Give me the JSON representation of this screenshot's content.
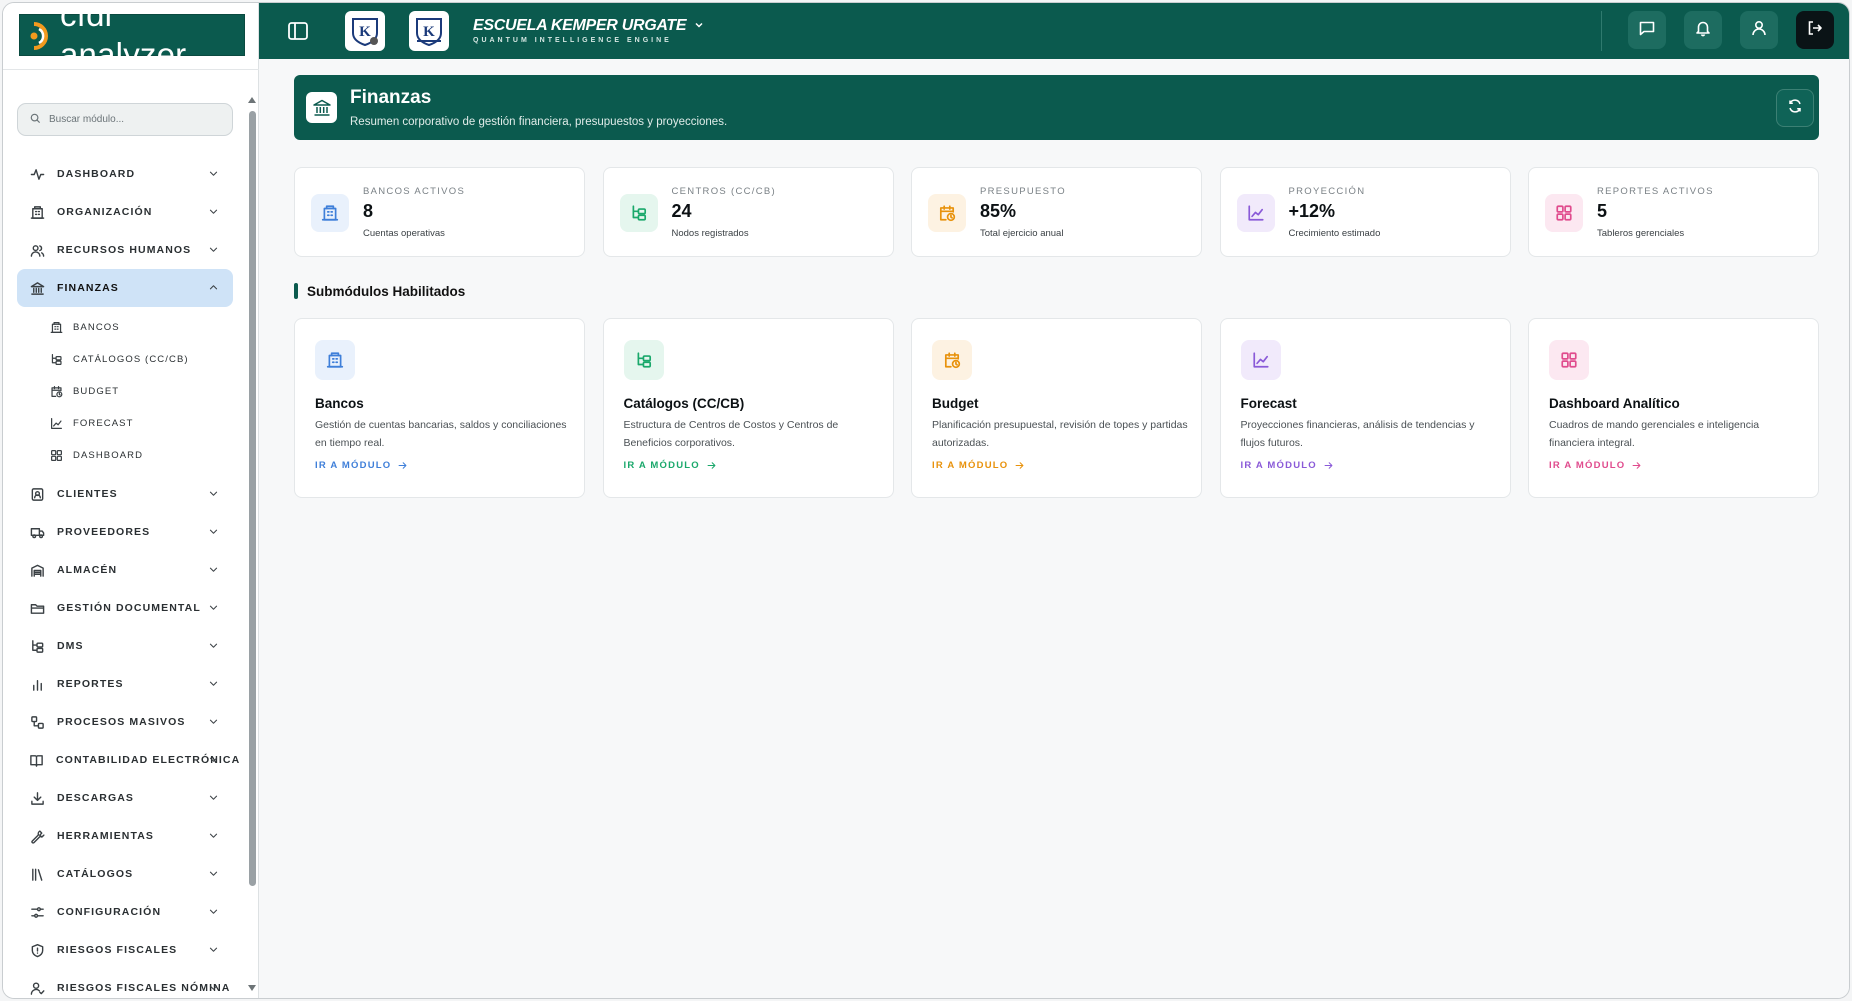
{
  "app": {
    "logo_text": "cfdi analyzer",
    "school_name": "ESCUELA KEMPER URGATE",
    "school_tagline": "QUANTUM INTELLIGENCE ENGINE",
    "badge_letter": "K"
  },
  "colors": {
    "brand": "#0b5a4e",
    "active_nav": "#cfe3f7",
    "blue": "#3f7fd9",
    "green": "#1aa86b",
    "orange": "#e8920c",
    "purple": "#8a5ad8",
    "pink": "#e04b8d"
  },
  "search": {
    "placeholder": "Buscar módulo..."
  },
  "sidebar": {
    "items": [
      {
        "label": "Dashboard",
        "icon": "activity-icon"
      },
      {
        "label": "Organización",
        "icon": "building-icon"
      },
      {
        "label": "Recursos Humanos",
        "icon": "users-icon"
      },
      {
        "label": "Finanzas",
        "icon": "landmark-icon",
        "active": true
      },
      {
        "label": "Clientes",
        "icon": "contact-icon"
      },
      {
        "label": "Proveedores",
        "icon": "truck-icon"
      },
      {
        "label": "Almacén",
        "icon": "warehouse-icon"
      },
      {
        "label": "Gestión Documental",
        "icon": "folder-icon"
      },
      {
        "label": "DMS",
        "icon": "tree-icon"
      },
      {
        "label": "Reportes",
        "icon": "bar-chart-icon"
      },
      {
        "label": "Procesos Masivos",
        "icon": "workflow-icon"
      },
      {
        "label": "Contabilidad Electrónica",
        "icon": "book-icon"
      },
      {
        "label": "Descargas",
        "icon": "download-icon"
      },
      {
        "label": "Herramientas",
        "icon": "wrench-icon"
      },
      {
        "label": "Catálogos",
        "icon": "library-icon"
      },
      {
        "label": "Configuración",
        "icon": "sliders-icon"
      },
      {
        "label": "Riesgos Fiscales",
        "icon": "shield-icon"
      },
      {
        "label": "Riesgos Fiscales Nómina",
        "icon": "user-check-icon"
      }
    ],
    "finanzas_sub": [
      {
        "label": "Bancos",
        "icon": "building-icon"
      },
      {
        "label": "Catálogos (CC/CB)",
        "icon": "tree-icon"
      },
      {
        "label": "Budget",
        "icon": "calendar-clock-icon"
      },
      {
        "label": "Forecast",
        "icon": "line-chart-icon"
      },
      {
        "label": "Dashboard",
        "icon": "grid-icon"
      }
    ]
  },
  "hero": {
    "title": "Finanzas",
    "subtitle": "Resumen corporativo de gestión financiera, presupuestos y proyecciones."
  },
  "stats": [
    {
      "label": "Bancos Activos",
      "value": "8",
      "note": "Cuentas operativas",
      "icon": "building-icon",
      "color": "#3f7fd9",
      "bg": "#e9f1fc"
    },
    {
      "label": "Centros (CC/CB)",
      "value": "24",
      "note": "Nodos registrados",
      "icon": "tree-icon",
      "color": "#1aa86b",
      "bg": "#e5f6ee"
    },
    {
      "label": "Presupuesto",
      "value": "85%",
      "note": "Total ejercicio anual",
      "icon": "calendar-clock-icon",
      "color": "#e8920c",
      "bg": "#fdf2e2"
    },
    {
      "label": "Proyección",
      "value": "+12%",
      "note": "Crecimiento estimado",
      "icon": "line-chart-icon",
      "color": "#8a5ad8",
      "bg": "#f1eafb"
    },
    {
      "label": "Reportes Activos",
      "value": "5",
      "note": "Tableros gerenciales",
      "icon": "grid-icon",
      "color": "#e04b8d",
      "bg": "#fce8f1"
    }
  ],
  "section_title": "Submódulos Habilitados",
  "modules": [
    {
      "title": "Bancos",
      "desc": "Gestión de cuentas bancarias, saldos y conciliaciones en tiempo real.",
      "link": "Ir a módulo",
      "icon": "building-icon",
      "color": "#3f7fd9",
      "bg": "#e9f1fc"
    },
    {
      "title": "Catálogos (CC/CB)",
      "desc": "Estructura de Centros de Costos y Centros de Beneficios corporativos.",
      "link": "Ir a módulo",
      "icon": "tree-icon",
      "color": "#1aa86b",
      "bg": "#e5f6ee"
    },
    {
      "title": "Budget",
      "desc": "Planificación presupuestal, revisión de topes y partidas autorizadas.",
      "link": "Ir a módulo",
      "icon": "calendar-clock-icon",
      "color": "#e8920c",
      "bg": "#fdf2e2"
    },
    {
      "title": "Forecast",
      "desc": "Proyecciones financieras, análisis de tendencias y flujos futuros.",
      "link": "Ir a módulo",
      "icon": "line-chart-icon",
      "color": "#8a5ad8",
      "bg": "#f1eafb"
    },
    {
      "title": "Dashboard Analítico",
      "desc": "Cuadros de mando gerenciales e inteligencia financiera integral.",
      "link": "Ir a módulo",
      "icon": "grid-icon",
      "color": "#e04b8d",
      "bg": "#fce8f1"
    }
  ]
}
